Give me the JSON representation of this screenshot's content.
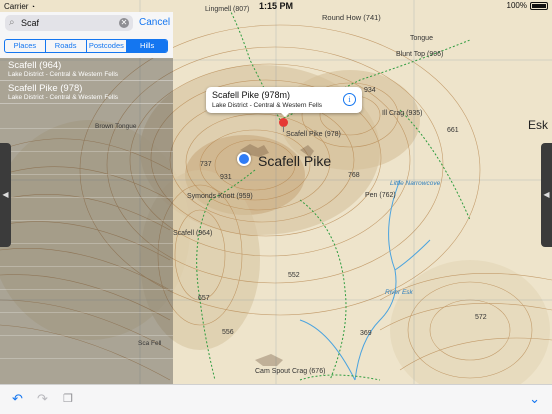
{
  "status_bar": {
    "carrier": "Carrier",
    "time": "1:15 PM",
    "battery": "100%"
  },
  "search": {
    "value": "Scaf",
    "cancel_label": "Cancel"
  },
  "segments": [
    {
      "label": "Places",
      "active": false
    },
    {
      "label": "Roads",
      "active": false
    },
    {
      "label": "Postcodes",
      "active": false
    },
    {
      "label": "Hills",
      "active": true
    }
  ],
  "results": [
    {
      "title": "Scafell (964)",
      "subtitle": "Lake District - Central & Western Fells"
    },
    {
      "title": "Scafell Pike (978)",
      "subtitle": "Lake District - Central & Western Fells"
    }
  ],
  "callout": {
    "title": "Scafell Pike (978m)",
    "subtitle": "Lake District - Central & Western Fells"
  },
  "map_labels": {
    "scafell_pike": "Scafell Pike",
    "scafell_pike_small": "Scafell Pike (978)",
    "round_how": "Round How (741)",
    "blunt_top": "Blunt Top (906)",
    "tongue": "Tongue",
    "lingmell": "Lingmell (807)",
    "ill_crag": "Ill Crag (935)",
    "symonds_knott": "Symonds Knott (959)",
    "scafell": "Scafell (964)",
    "pen": "Pen (762)",
    "little_narrowcove": "Little Narrowcove",
    "river_esk": "River Esk",
    "cam_spout_crag": "Cam Spout Crag (676)",
    "esk": "Esk",
    "brown_tongue": "Brown Tongue",
    "sca_fell": "Sca Fell",
    "h934": "934",
    "h931": "931",
    "h737": "737",
    "h768": "768",
    "h661": "661",
    "h552": "552",
    "h657": "657",
    "h572": "572",
    "h369": "369",
    "h556": "556"
  },
  "icons": {
    "wifi": "wifi-icon",
    "search": "search-icon",
    "clear": "clear-icon",
    "info": "info-icon",
    "pin": "pin-icon",
    "location": "location-dot-icon",
    "undo": "undo-icon",
    "redo": "redo-icon",
    "copy": "copy-icon",
    "chevron": "chevron-down-icon"
  },
  "colors": {
    "accent": "#1476f0",
    "pin": "#e53935",
    "location": "#2f7cf6",
    "water": "#4aa3df",
    "path": "#2e9c3f"
  }
}
